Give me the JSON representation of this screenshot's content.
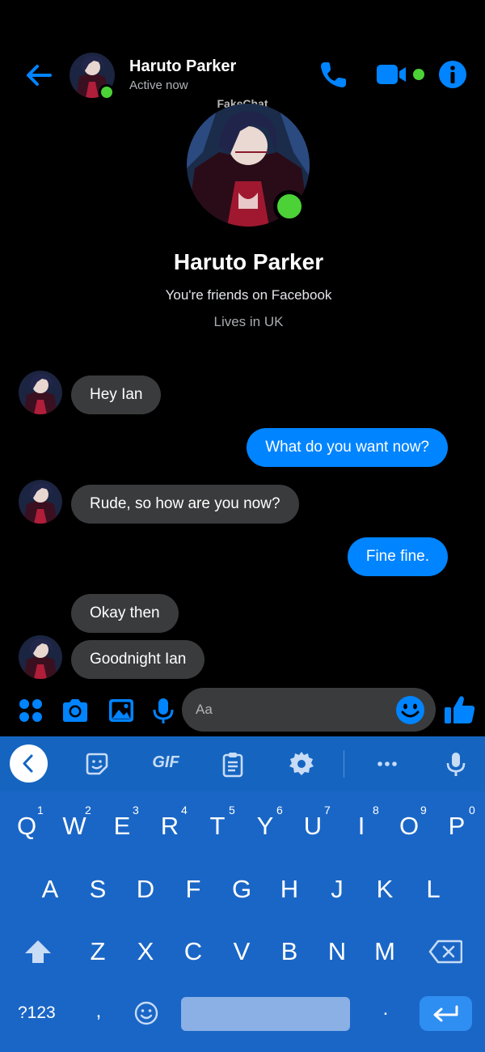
{
  "header": {
    "name": "Haruto Parker",
    "status": "Active now",
    "watermark": "FakeChat"
  },
  "profile": {
    "name": "Haruto Parker",
    "friends_text": "You're friends on Facebook",
    "lives_text": "Lives in UK"
  },
  "messages": [
    {
      "from": "them",
      "text": "Hey Ian"
    },
    {
      "from": "me",
      "text": "What do you want now?"
    },
    {
      "from": "them",
      "text": "Rude, so how are you now?"
    },
    {
      "from": "me",
      "text": "Fine fine."
    },
    {
      "from": "them",
      "text": "Okay then"
    },
    {
      "from": "them",
      "text": "Goodnight Ian"
    }
  ],
  "composer": {
    "placeholder": "Aa"
  },
  "keyboard": {
    "toolbar": {
      "gif_label": "GIF"
    },
    "row1": [
      "Q",
      "W",
      "E",
      "R",
      "T",
      "Y",
      "U",
      "I",
      "O",
      "P"
    ],
    "row1_numbers": [
      "1",
      "2",
      "3",
      "4",
      "5",
      "6",
      "7",
      "8",
      "9",
      "0"
    ],
    "row2": [
      "A",
      "S",
      "D",
      "F",
      "G",
      "H",
      "J",
      "K",
      "L"
    ],
    "row3": [
      "Z",
      "X",
      "C",
      "V",
      "B",
      "N",
      "M"
    ],
    "symbols_label": "?123",
    "comma": ",",
    "period": "."
  },
  "colors": {
    "accent": "#0084ff",
    "online": "#4cd137",
    "incoming_bubble": "#3a3b3c",
    "keyboard_bg": "#1a66c6"
  },
  "icons": [
    "back-arrow-icon",
    "phone-icon",
    "video-camera-icon",
    "info-icon",
    "apps-grid-icon",
    "camera-icon",
    "image-icon",
    "microphone-icon",
    "emoji-icon",
    "thumbs-up-icon"
  ]
}
